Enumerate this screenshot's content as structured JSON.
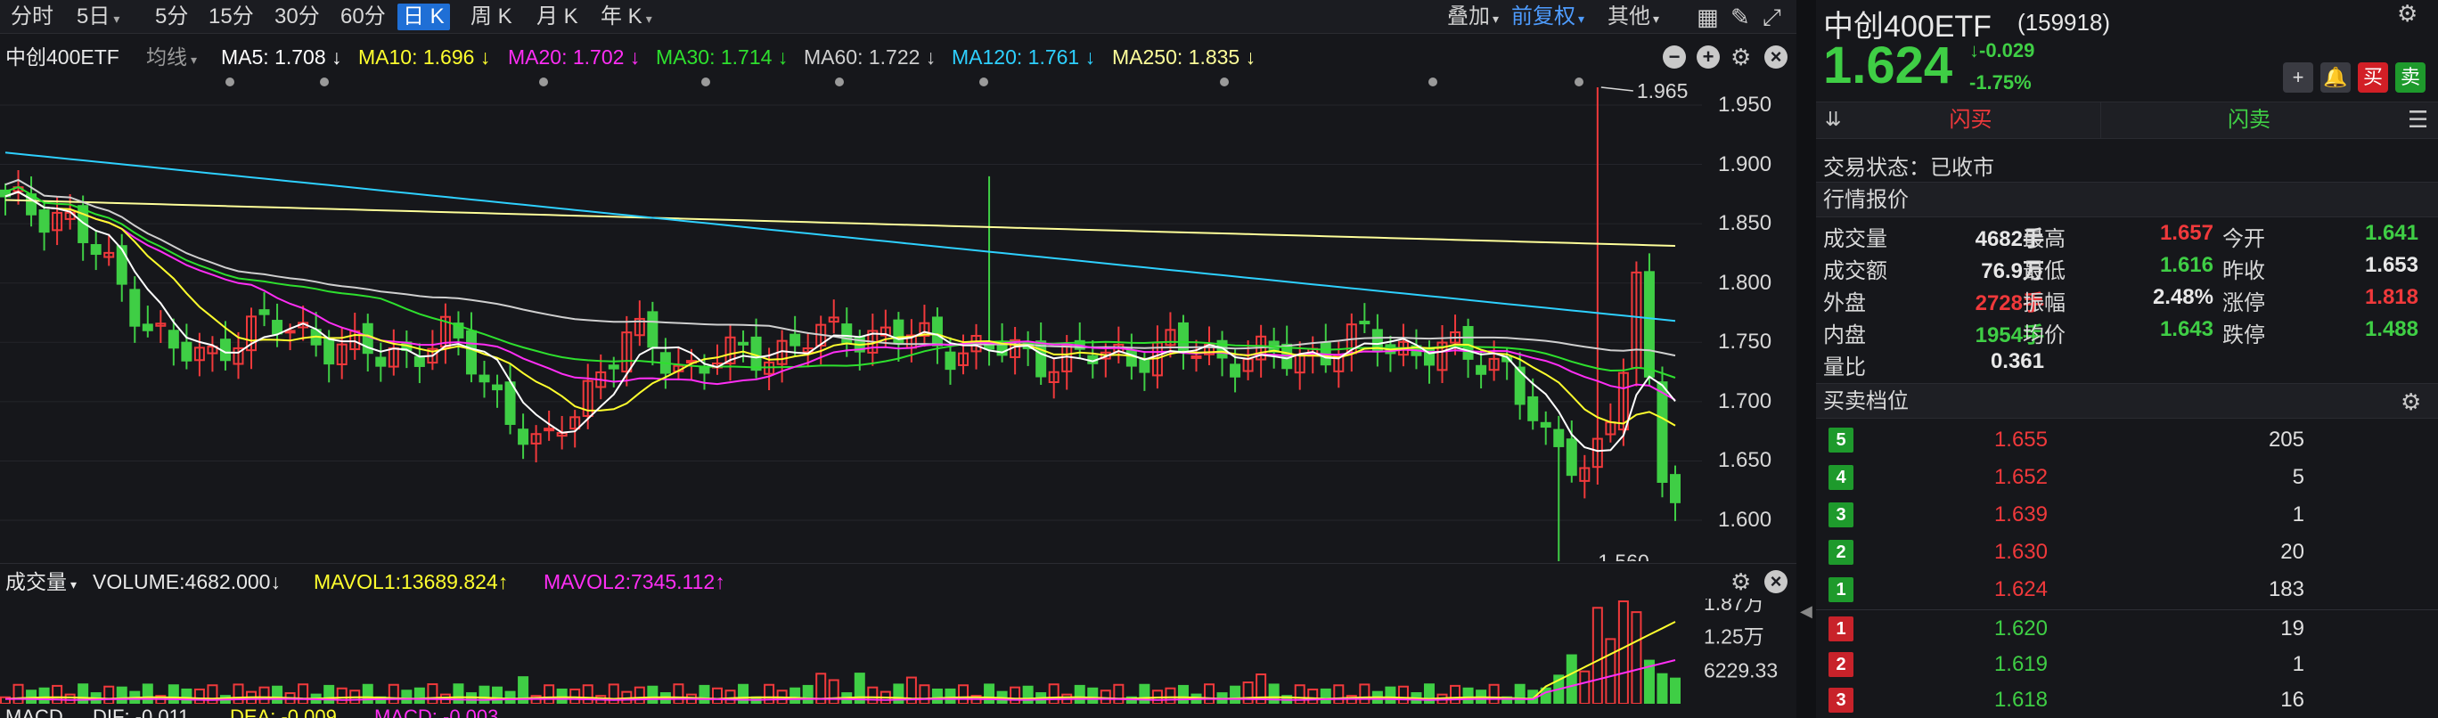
{
  "toolbar": {
    "timeframes": [
      "分时",
      "5日",
      "5分",
      "15分",
      "30分",
      "60分",
      "日 K",
      "周 K",
      "月 K",
      "年 K"
    ],
    "active_timeframe": "日 K",
    "overlay_label": "叠加",
    "adjust_label": "前复权",
    "other_label": "其他"
  },
  "ma_bar": {
    "name": "中创400ETF",
    "avg_label": "均线",
    "ma5": "MA5: 1.708 ↓",
    "ma10": "MA10: 1.696 ↓",
    "ma20": "MA20: 1.702 ↓",
    "ma30": "MA30: 1.714 ↓",
    "ma60": "MA60: 1.722 ↓",
    "ma120": "MA120: 1.761 ↓",
    "ma250": "MA250: 1.835 ↓"
  },
  "price_axis": {
    "ticks": [
      "1.950",
      "1.900",
      "1.850",
      "1.800",
      "1.750",
      "1.700",
      "1.650",
      "1.600"
    ],
    "high_annotation": "1.965",
    "low_annotation": "1.560"
  },
  "volume": {
    "label": "成交量",
    "volume_text": "VOLUME:4682.000↓",
    "mavol1_text": "MAVOL1:13689.824↑",
    "mavol2_text": "MAVOL2:7345.112↑",
    "ticks": [
      "1.87万",
      "1.25万",
      "6229.33"
    ]
  },
  "macd_head": {
    "label": "MACD",
    "dif": "DIF: -0.011",
    "dea": "DEA: -0.009",
    "macd": "MACD: -0.003"
  },
  "quote": {
    "name": "中创400ETF",
    "code": "(159918)",
    "price": "1.624",
    "change": "-0.029",
    "change_pct": "-1.75%",
    "buy_label": "闪买",
    "sell_label": "闪卖",
    "trade_status": "交易状态：已收市",
    "section_quote": "行情报价",
    "section_orderbook": "买卖档位"
  },
  "stats": [
    {
      "label": "成交量",
      "value": "4682手",
      "color": "white"
    },
    {
      "label": "最高",
      "value": "1.657",
      "color": "red"
    },
    {
      "label": "今开",
      "value": "1.641",
      "color": "green"
    },
    {
      "label": "成交额",
      "value": "76.9万",
      "color": "white"
    },
    {
      "label": "最低",
      "value": "1.616",
      "color": "green"
    },
    {
      "label": "昨收",
      "value": "1.653",
      "color": "white"
    },
    {
      "label": "外盘",
      "value": "2728手",
      "color": "red"
    },
    {
      "label": "振幅",
      "value": "2.48%",
      "color": "white"
    },
    {
      "label": "涨停",
      "value": "1.818",
      "color": "red"
    },
    {
      "label": "内盘",
      "value": "1954手",
      "color": "green"
    },
    {
      "label": "均价",
      "value": "1.643",
      "color": "green"
    },
    {
      "label": "跌停",
      "value": "1.488",
      "color": "green"
    },
    {
      "label": "量比",
      "value": "0.361",
      "color": "white"
    }
  ],
  "orderbook": {
    "asks": [
      {
        "level": "5",
        "price": "1.655",
        "vol": "205"
      },
      {
        "level": "4",
        "price": "1.652",
        "vol": "5"
      },
      {
        "level": "3",
        "price": "1.639",
        "vol": "1"
      },
      {
        "level": "2",
        "price": "1.630",
        "vol": "20"
      },
      {
        "level": "1",
        "price": "1.624",
        "vol": "183"
      }
    ],
    "bids": [
      {
        "level": "1",
        "price": "1.620",
        "vol": "19"
      },
      {
        "level": "2",
        "price": "1.619",
        "vol": "1"
      },
      {
        "level": "3",
        "price": "1.618",
        "vol": "16"
      }
    ]
  },
  "colors": {
    "up": "#f0393b",
    "down": "#3fce45",
    "ma5": "#ffffff",
    "ma10": "#ffff2e",
    "ma20": "#ff2ef5",
    "ma30": "#2ee02e",
    "ma60": "#cfcfcf",
    "ma120": "#2ed0ff",
    "ma250": "#ffff9a"
  }
}
